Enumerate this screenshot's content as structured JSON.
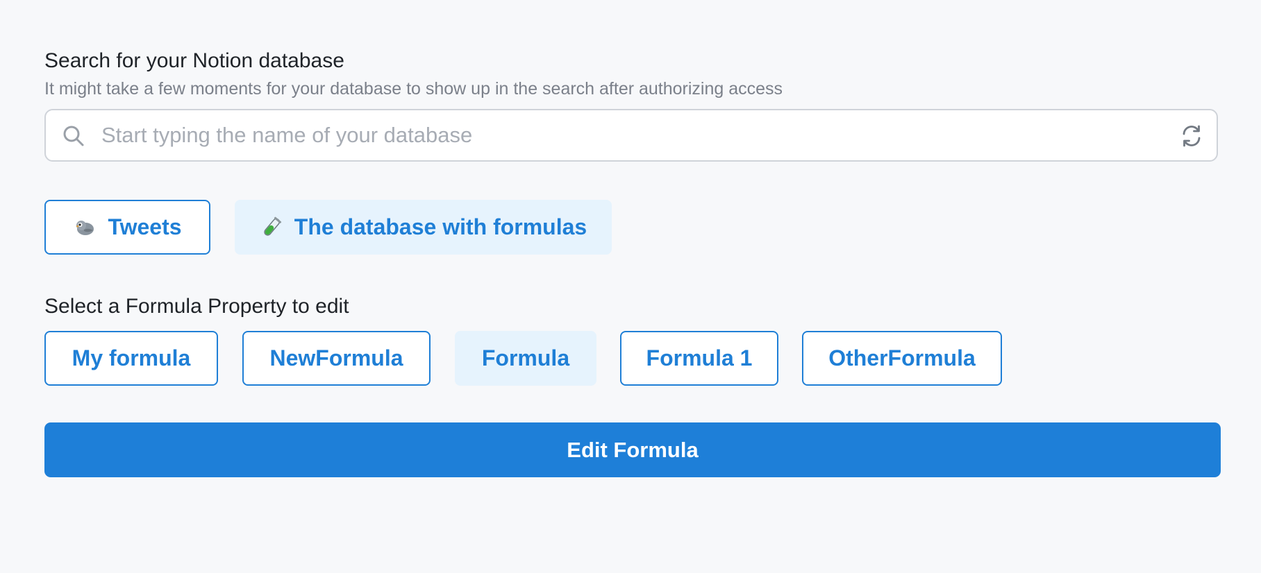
{
  "search_section": {
    "title": "Search for your Notion database",
    "subtitle": "It might take a few moments for your database to show up in the search after authorizing access",
    "placeholder": "Start typing the name of your database",
    "search_icon": "search-icon",
    "refresh_icon": "refresh-icon"
  },
  "databases": [
    {
      "label": "Tweets",
      "icon": "bird-icon",
      "selected": false
    },
    {
      "label": "The database with formulas",
      "icon": "test-tube-icon",
      "selected": true
    }
  ],
  "formula_section": {
    "title": "Select a Formula Property to edit",
    "properties": [
      {
        "label": "My formula",
        "selected": false
      },
      {
        "label": "NewFormula",
        "selected": false
      },
      {
        "label": "Formula",
        "selected": true
      },
      {
        "label": "Formula 1",
        "selected": false
      },
      {
        "label": "OtherFormula",
        "selected": false
      }
    ]
  },
  "edit_button_label": "Edit Formula",
  "colors": {
    "accent": "#1e7fd8",
    "selected_bg": "#e6f3fd",
    "background": "#f7f8fa"
  }
}
